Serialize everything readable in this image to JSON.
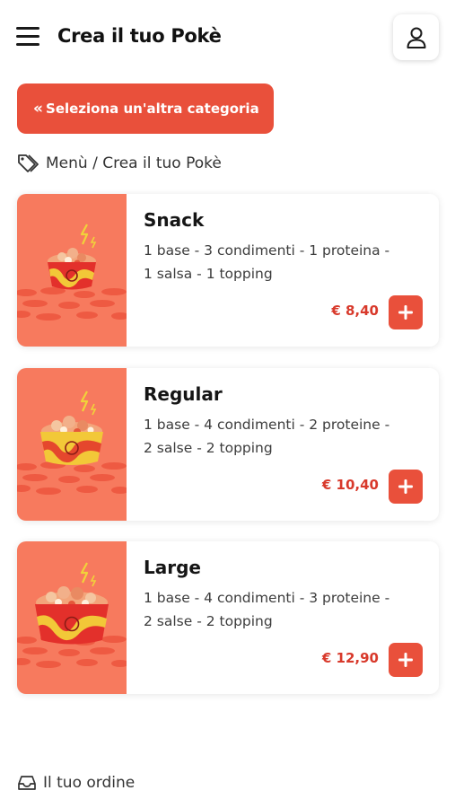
{
  "header": {
    "title": "Crea il tuo Pokè",
    "menu_icon": "hamburger-menu-icon",
    "user_icon": "user-icon"
  },
  "back_button": {
    "label": "Seleziona un'altra categoria",
    "icon": "double-chevron-left-icon"
  },
  "breadcrumb": {
    "icon": "tag-icon",
    "text": "Menù / Crea il tuo Pokè"
  },
  "products": [
    {
      "name": "Snack",
      "desc_line1": "1 base - 3 condimenti - 1 proteina -",
      "desc_line2": "1 salsa - 1 topping",
      "price": "€ 8,40"
    },
    {
      "name": "Regular",
      "desc_line1": "1 base - 4 condimenti - 2 proteine -",
      "desc_line2": "2 salse - 2 topping",
      "price": "€ 10,40"
    },
    {
      "name": "Large",
      "desc_line1": "1 base - 4 condimenti - 3 proteine -",
      "desc_line2": "2 salse - 2 topping",
      "price": "€ 12,90"
    }
  ],
  "footer": {
    "order_label": "Il tuo ordine",
    "order_icon": "inbox-tray-icon"
  },
  "colors": {
    "accent": "#e9503b",
    "price": "#d8392b",
    "thumb_background": "#f77a5e"
  }
}
